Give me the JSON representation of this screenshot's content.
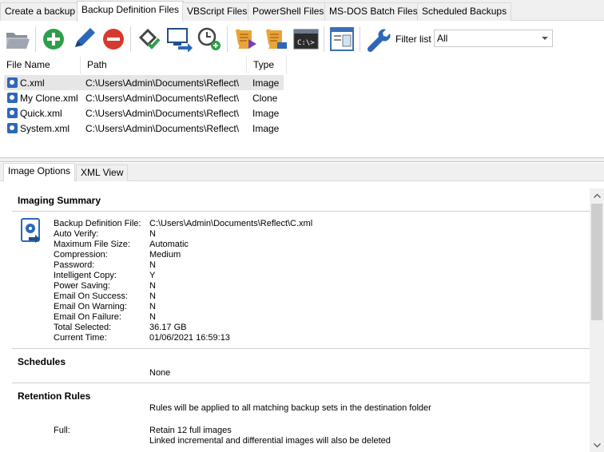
{
  "tabs": [
    {
      "label": "Create a backup"
    },
    {
      "label": "Backup Definition Files",
      "active": true
    },
    {
      "label": "VBScript Files"
    },
    {
      "label": "PowerShell Files"
    },
    {
      "label": "MS-DOS Batch Files"
    },
    {
      "label": "Scheduled Backups"
    }
  ],
  "toolbar": {
    "buttons": [
      {
        "icon": "folder-open-icon"
      },
      {
        "icon": "add-icon"
      },
      {
        "icon": "edit-pencil-icon"
      },
      {
        "icon": "remove-icon"
      },
      {
        "icon": "verify-check-icon"
      },
      {
        "icon": "run-backup-icon"
      },
      {
        "icon": "schedule-clock-icon"
      },
      {
        "icon": "vbscript-icon"
      },
      {
        "icon": "powershell-icon"
      },
      {
        "icon": "command-prompt-icon"
      },
      {
        "icon": "view-image-icon"
      },
      {
        "icon": "wrench-icon"
      }
    ],
    "filter_label": "Filter list",
    "filter_value": "All"
  },
  "file_list": {
    "columns": [
      "File Name",
      "Path",
      "Type"
    ],
    "rows": [
      {
        "name": "C.xml",
        "path": "C:\\Users\\Admin\\Documents\\Reflect\\",
        "type": "Image",
        "selected": true
      },
      {
        "name": "My Clone.xml",
        "path": "C:\\Users\\Admin\\Documents\\Reflect\\",
        "type": "Clone"
      },
      {
        "name": "Quick.xml",
        "path": "C:\\Users\\Admin\\Documents\\Reflect\\",
        "type": "Image"
      },
      {
        "name": "System.xml",
        "path": "C:\\Users\\Admin\\Documents\\Reflect\\",
        "type": "Image"
      }
    ]
  },
  "lower_tabs": [
    {
      "label": "Image Options",
      "active": true
    },
    {
      "label": "XML View"
    }
  ],
  "summary": {
    "title": "Imaging Summary",
    "fields": [
      {
        "label": "Backup Definition File:",
        "value": "C:\\Users\\Admin\\Documents\\Reflect\\C.xml"
      },
      {
        "label": "Auto Verify:",
        "value": "N"
      },
      {
        "label": "Maximum File Size:",
        "value": "Automatic"
      },
      {
        "label": "Compression:",
        "value": "Medium"
      },
      {
        "label": "Password:",
        "value": "N"
      },
      {
        "label": "Intelligent Copy:",
        "value": "Y"
      },
      {
        "label": "Power Saving:",
        "value": "N"
      },
      {
        "label": "Email On Success:",
        "value": "N"
      },
      {
        "label": "Email On Warning:",
        "value": "N"
      },
      {
        "label": "Email On Failure:",
        "value": "N"
      },
      {
        "label": "Total Selected:",
        "value": "36.17 GB"
      },
      {
        "label": "Current Time:",
        "value": "01/06/2021 16:59:13"
      }
    ]
  },
  "schedules": {
    "title": "Schedules",
    "value": "None"
  },
  "retention": {
    "title": "Retention Rules",
    "note": "Rules will be applied to all matching backup sets in the destination folder",
    "full_label": "Full:",
    "full_line1": "Retain 12 full images",
    "full_line2": "Linked incremental and differential images will also be deleted"
  }
}
